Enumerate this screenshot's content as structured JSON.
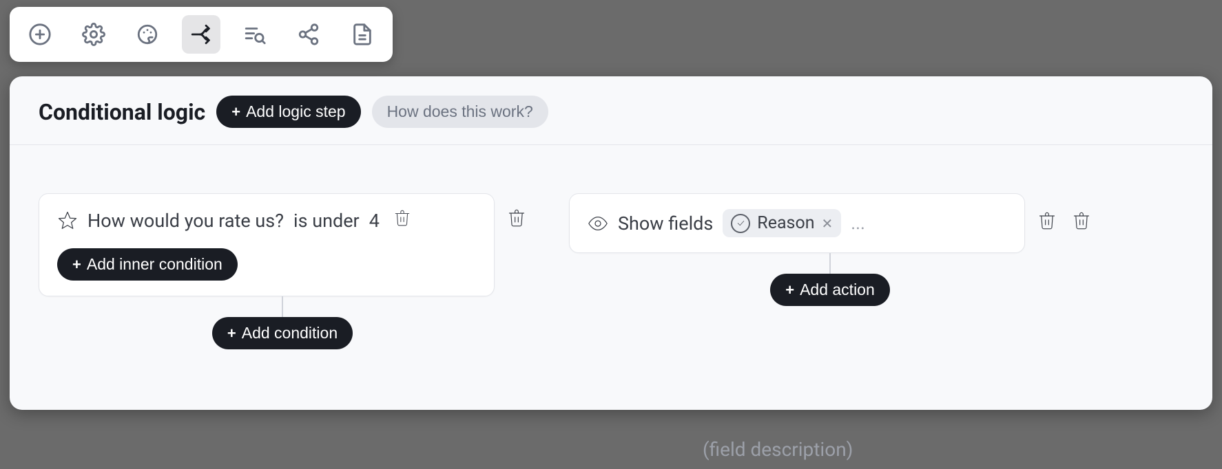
{
  "toolbar": {
    "icons": [
      "plus-circle",
      "gear",
      "palette",
      "branches",
      "text-search",
      "share",
      "file"
    ]
  },
  "header": {
    "title": "Conditional logic",
    "add_logic_step_label": "Add logic step",
    "help_label": "How does this work?"
  },
  "condition_block": {
    "rows": [
      {
        "field": "How would you rate us?",
        "operator": "is under",
        "value": "4"
      }
    ],
    "add_inner_condition_label": "Add inner condition",
    "add_condition_label": "Add condition"
  },
  "action_block": {
    "action_label": "Show fields",
    "tags": [
      {
        "name": "Reason"
      }
    ],
    "more_placeholder": "...",
    "add_action_label": "Add action"
  },
  "ghost_background_text": "(field description)"
}
